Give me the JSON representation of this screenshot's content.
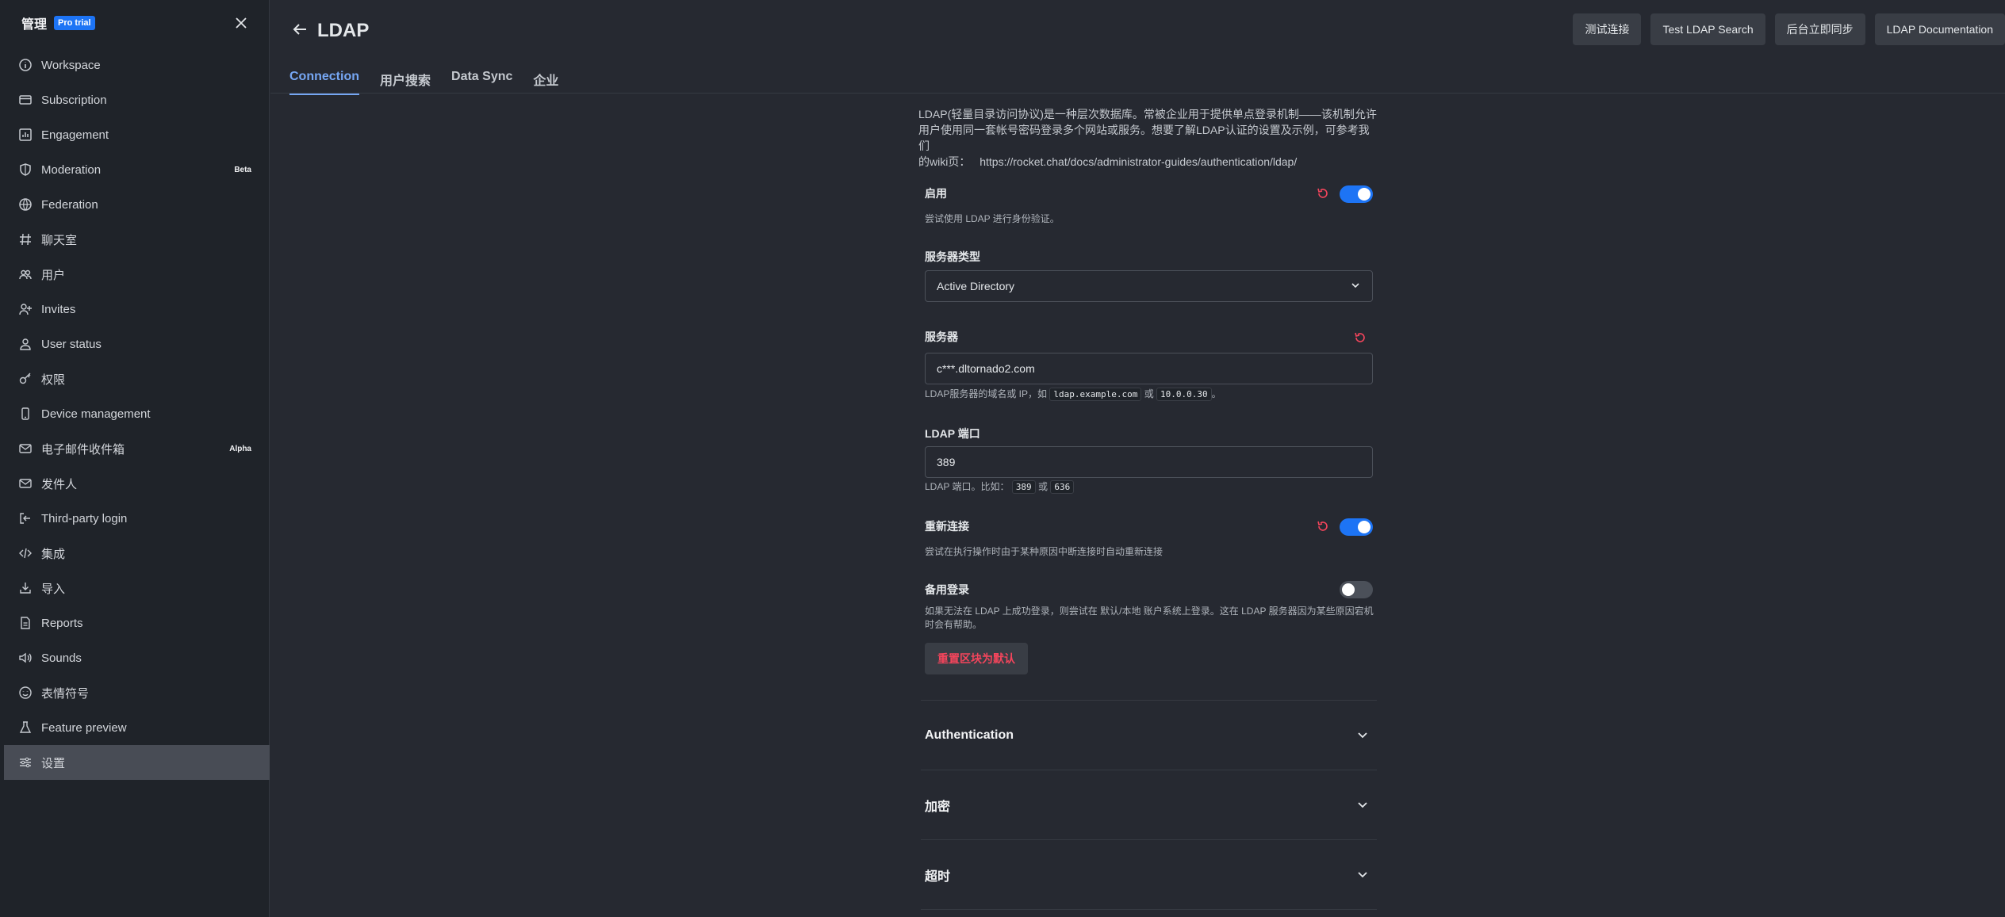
{
  "sidebar": {
    "title": "管理",
    "badge": "Pro trial",
    "items": [
      {
        "label": "Workspace",
        "icon": "info-icon"
      },
      {
        "label": "Subscription",
        "icon": "card-icon"
      },
      {
        "label": "Engagement",
        "icon": "chart-icon"
      },
      {
        "label": "Moderation",
        "icon": "shield-icon",
        "tag": "Beta"
      },
      {
        "label": "Federation",
        "icon": "globe-icon"
      },
      {
        "label": "聊天室",
        "icon": "hash-icon"
      },
      {
        "label": "用户",
        "icon": "users-icon"
      },
      {
        "label": "Invites",
        "icon": "user-plus-icon"
      },
      {
        "label": "User status",
        "icon": "user-icon"
      },
      {
        "label": "权限",
        "icon": "key-icon"
      },
      {
        "label": "Device management",
        "icon": "mobile-icon"
      },
      {
        "label": "电子邮件收件箱",
        "icon": "mail-icon",
        "tag": "Alpha"
      },
      {
        "label": "发件人",
        "icon": "mail-icon"
      },
      {
        "label": "Third-party login",
        "icon": "login-icon"
      },
      {
        "label": "集成",
        "icon": "code-icon"
      },
      {
        "label": "导入",
        "icon": "import-icon"
      },
      {
        "label": "Reports",
        "icon": "file-icon"
      },
      {
        "label": "Sounds",
        "icon": "sound-icon"
      },
      {
        "label": "表情符号",
        "icon": "emoji-icon"
      },
      {
        "label": "Feature preview",
        "icon": "flask-icon"
      },
      {
        "label": "设置",
        "icon": "settings-icon",
        "active": true
      }
    ]
  },
  "header": {
    "title": "LDAP",
    "buttons": [
      "测试连接",
      "Test LDAP Search",
      "后台立即同步",
      "LDAP Documentation"
    ],
    "tabs": [
      "Connection",
      "用户搜索",
      "Data Sync",
      "企业"
    ]
  },
  "intro": {
    "line1": "LDAP(轻量目录访问协议)是一种层次数据库。常被企业用于提供单点登录机制——该机制允许",
    "line2": "用户使用同一套帐号密码登录多个网站或服务。想要了解LDAP认证的设置及示例，可参考我们",
    "line3_prefix": "的wiki页：",
    "line3_link": "https://rocket.chat/docs/administrator-guides/authentication/ldap/"
  },
  "fields": {
    "enable": {
      "label": "启用",
      "desc": "尝试使用 LDAP 进行身份验证。",
      "on": true
    },
    "server_type": {
      "label": "服务器类型",
      "value": "Active Directory"
    },
    "server": {
      "label": "服务器",
      "value": "c***.dltornado2.com",
      "desc_prefix": "LDAP服务器的域名或 IP，如",
      "code1": "ldap.example.com",
      "desc_or": "或",
      "code2": "10.0.0.30",
      "desc_suffix": "。"
    },
    "port": {
      "label": "LDAP 端口",
      "value": "389",
      "desc_prefix": "LDAP 端口。比如：",
      "code1": "389",
      "desc_or": "或",
      "code2": "636"
    },
    "reconnect": {
      "label": "重新连接",
      "desc": "尝试在执行操作时由于某种原因中断连接时自动重新连接",
      "on": true
    },
    "fallback": {
      "label": "备用登录",
      "desc1": "如果无法在 LDAP 上成功登录，则尝试在 默认/本地 账户系统上登录。这在 LDAP 服务器因为某些原因宕机",
      "desc2": "时会有帮助。",
      "on": false
    }
  },
  "reset_section_label": "重置区块为默认",
  "sections": [
    "Authentication",
    "加密",
    "超时"
  ],
  "colors": {
    "accent": "#1d74f5",
    "tab_active": "#76a7f4",
    "danger": "#f5455c"
  }
}
